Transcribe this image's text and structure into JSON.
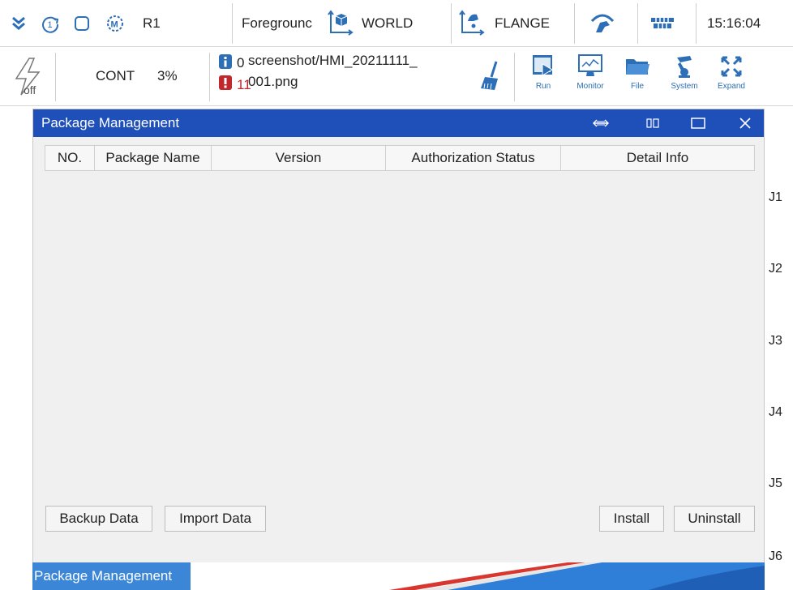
{
  "topbar": {
    "robot": "R1",
    "coord_mode": "Foregrounc",
    "world": "WORLD",
    "tool": "FLANGE",
    "time": "15:16:04"
  },
  "secondbar": {
    "power_label": "off",
    "mode": "CONT",
    "speed": "3%",
    "info_count": "0",
    "error_count": "11",
    "file_line1": "screenshot/HMI_20211111_",
    "file_line2": "001.png",
    "tools": [
      {
        "label": "Run",
        "icon": "run-icon"
      },
      {
        "label": "Monitor",
        "icon": "monitor-icon"
      },
      {
        "label": "File",
        "icon": "folder-icon"
      },
      {
        "label": "System",
        "icon": "robot-arm-icon"
      },
      {
        "label": "Expand",
        "icon": "expand-icon"
      }
    ]
  },
  "dialog": {
    "title": "Package Management",
    "columns": [
      "NO.",
      "Package Name",
      "Version",
      "Authorization Status",
      "Detail Info"
    ],
    "buttons": {
      "backup": "Backup Data",
      "import": "Import Data",
      "install": "Install",
      "uninstall": "Uninstall"
    }
  },
  "joints": [
    "J1",
    "J2",
    "J3",
    "J4",
    "J5",
    "J6"
  ],
  "taskbar": {
    "item": "Package Management"
  },
  "colors": {
    "title_bar": "#1f4fb8",
    "icon_blue": "#2c6fb7",
    "error_red": "#c0282d",
    "taskbar_item": "#3b86d6"
  }
}
